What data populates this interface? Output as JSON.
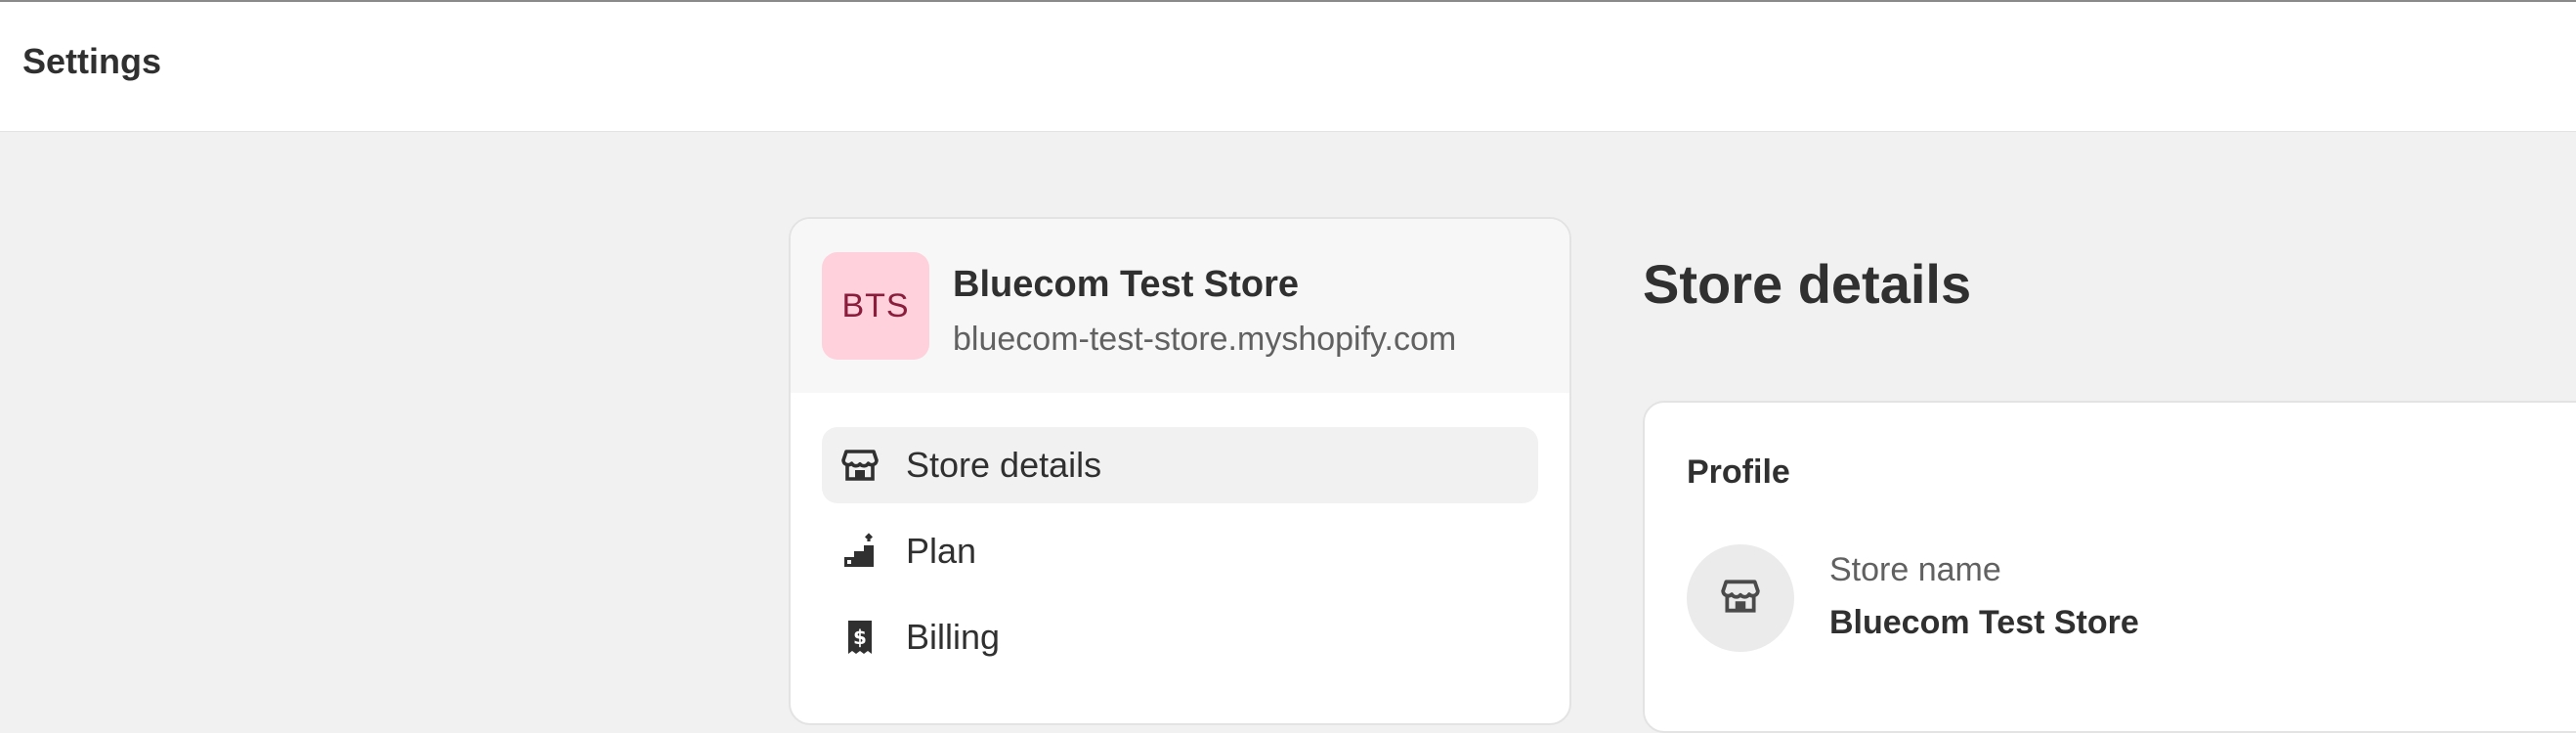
{
  "topbar": {
    "title": "Settings"
  },
  "store": {
    "initials": "BTS",
    "name": "Bluecom Test Store",
    "domain": "bluecom-test-store.myshopify.com"
  },
  "nav": {
    "items": [
      {
        "label": "Store details",
        "icon": "store-icon",
        "active": true
      },
      {
        "label": "Plan",
        "icon": "plan-icon",
        "active": false
      },
      {
        "label": "Billing",
        "icon": "billing-icon",
        "active": false
      }
    ]
  },
  "main": {
    "heading": "Store details",
    "profile": {
      "title": "Profile",
      "field_label": "Store name",
      "field_value": "Bluecom Test Store",
      "icon": "store-icon"
    }
  },
  "colors": {
    "avatar_bg": "#ffd1dc",
    "avatar_text": "#8a1d3c",
    "active_item_bg": "#f1f1f1",
    "page_bg": "#f1f1f1"
  }
}
